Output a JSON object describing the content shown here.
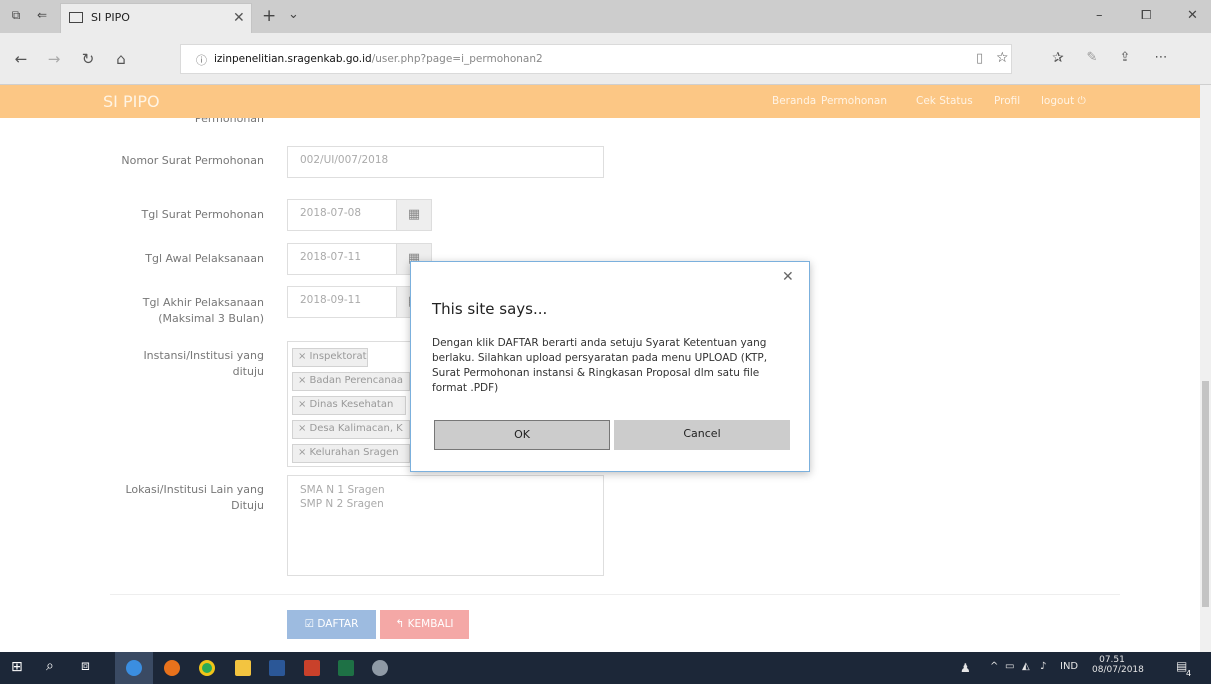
{
  "browser": {
    "tab_title": "SI PIPO",
    "url_domain": "izinpenelitian.sragenkab.go.id",
    "url_path": "/user.php?page=i_permohonan2"
  },
  "site": {
    "brand": "SI PIPO",
    "menu": [
      "Beranda",
      "Permohonan",
      "Cek Status",
      "Profil",
      "logout"
    ]
  },
  "form": {
    "cut_label": "Permohonan",
    "nomor_label": "Nomor Surat Permohonan",
    "nomor_value": "002/UI/007/2018",
    "tgl_surat_label": "Tgl Surat Permohonan",
    "tgl_surat_value": "2018-07-08",
    "tgl_awal_label": "Tgl Awal Pelaksanaan",
    "tgl_awal_value": "2018-07-11",
    "tgl_akhir_label": "Tgl Akhir Pelaksanaan",
    "tgl_akhir_sub": "(Maksimal 3 Bulan)",
    "tgl_akhir_value": "2018-09-11",
    "instansi_label": "Instansi/Institusi yang dituju",
    "instansi_tags": [
      "× Inspektorat",
      "× Badan Perencanaa",
      "× Dinas Kesehatan",
      "× Desa Kalimacan, K",
      "× Kelurahan Sragen"
    ],
    "lokasi_label": "Lokasi/Institusi Lain yang Dituju",
    "lokasi_lines": [
      "SMA N 1 Sragen",
      "SMP N 2 Sragen"
    ],
    "daftar": "DAFTAR",
    "kembali": "KEMBALI"
  },
  "dialog": {
    "title": "This site says...",
    "message": "Dengan klik DAFTAR berarti anda setuju Syarat Ketentuan yang berlaku. Silahkan upload persyaratan pada menu UPLOAD (KTP, Surat Permohonan instansi & Ringkasan Proposal dlm satu file format .PDF)",
    "ok": "OK",
    "cancel": "Cancel"
  },
  "taskbar": {
    "lang": "IND",
    "time": "07.51",
    "date": "08/07/2018",
    "notif": "4"
  },
  "colors": {
    "navbar": "#fcc785",
    "primary_btn": "#9dbbe0",
    "danger_btn": "#f4a8a6",
    "taskbar": "#1c2738"
  }
}
